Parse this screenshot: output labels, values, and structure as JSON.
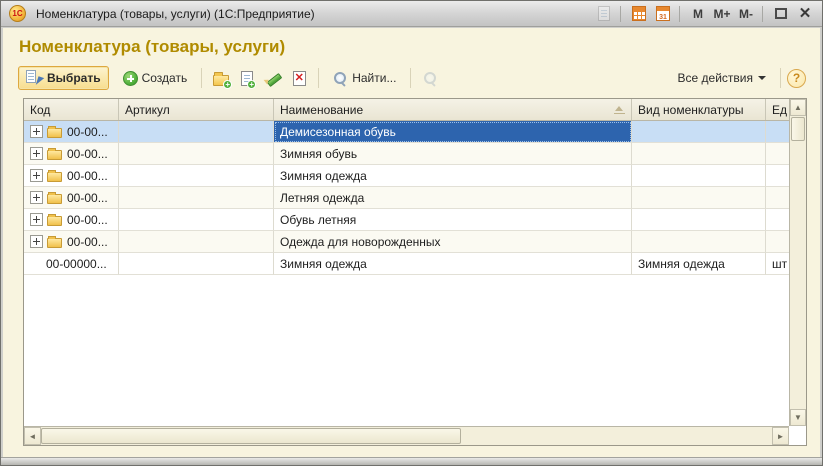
{
  "titlebar": {
    "app_logo_text": "1С",
    "title": "Номенклатура (товары, услуги)  (1С:Предприятие)",
    "calendar_label": "31",
    "buttons": {
      "m": "М",
      "m_plus": "М+",
      "m_minus": "М-",
      "close": "✕"
    }
  },
  "page": {
    "title": "Номенклатура (товары, услуги)"
  },
  "toolbar": {
    "select_label": "Выбрать",
    "create_label": "Создать",
    "find_label": "Найти...",
    "all_actions_label": "Все действия",
    "help_label": "?"
  },
  "table": {
    "columns": {
      "code": "Код",
      "article": "Артикул",
      "name": "Наименование",
      "type": "Вид номенклатуры",
      "unit": "Ед"
    },
    "rows": [
      {
        "code": "00-00...",
        "article": "",
        "name": "Демисезонная обувь",
        "type": "",
        "unit": "",
        "is_group": true,
        "selected": true
      },
      {
        "code": "00-00...",
        "article": "",
        "name": "Зимняя обувь",
        "type": "",
        "unit": "",
        "is_group": true,
        "selected": false
      },
      {
        "code": "00-00...",
        "article": "",
        "name": "Зимняя одежда",
        "type": "",
        "unit": "",
        "is_group": true,
        "selected": false
      },
      {
        "code": "00-00...",
        "article": "",
        "name": "Летняя одежда",
        "type": "",
        "unit": "",
        "is_group": true,
        "selected": false
      },
      {
        "code": "00-00...",
        "article": "",
        "name": "Обувь летняя",
        "type": "",
        "unit": "",
        "is_group": true,
        "selected": false
      },
      {
        "code": "00-00...",
        "article": "",
        "name": "Одежда для новорожденных",
        "type": "",
        "unit": "",
        "is_group": true,
        "selected": false
      },
      {
        "code": "00-00000...",
        "article": "",
        "name": "Зимняя одежда",
        "type": "Зимняя одежда",
        "unit": "шт",
        "is_group": false,
        "selected": false
      }
    ]
  },
  "colors": {
    "page_title": "#b08b00",
    "selected_cell_bg": "#2d64ae",
    "selected_row_bg": "#c8def5",
    "window_bg": "#f8f4df",
    "accent_button_border": "#dea83f"
  }
}
